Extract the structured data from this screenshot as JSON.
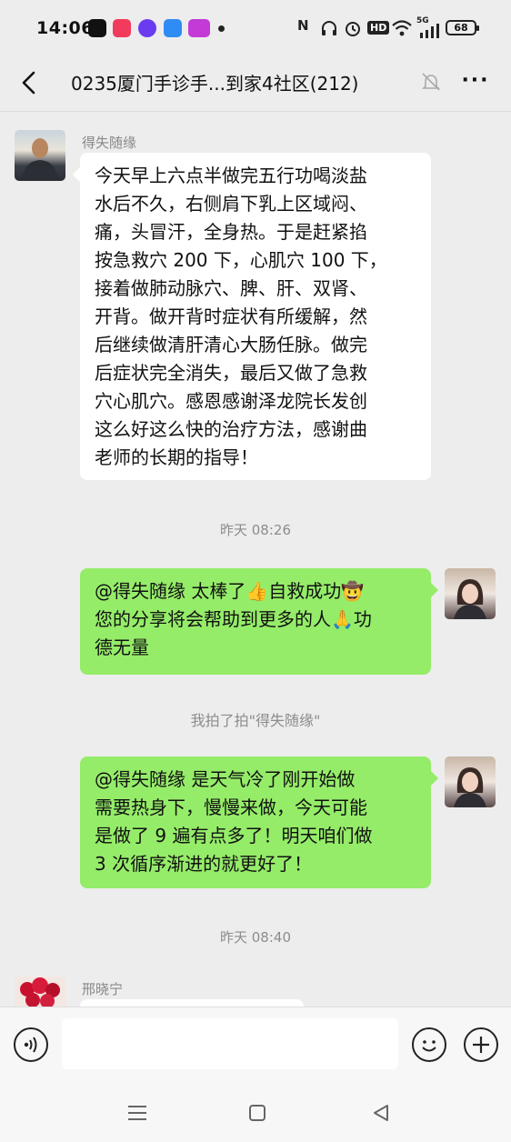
{
  "status_bar": {
    "time": "14:06",
    "battery": "68",
    "signal": "5G",
    "hd": "HD"
  },
  "header": {
    "title": "0235厦门手诊手...到家4社区(212)"
  },
  "messages": [
    {
      "type": "incoming",
      "sender": "得失随缘",
      "lines": [
        "今天早上六点半做完五行功喝淡盐",
        "水后不久，右侧肩下乳上区域闷、",
        "痛，头冒汗，全身热。于是赶紧掐",
        "按急救穴 200 下，心肌穴 100 下，",
        "接着做肺动脉穴、脾、肝、双肾、",
        "开背。做开背时症状有所缓解，然",
        "后继续做清肝清心大肠任脉。做完",
        "后症状完全消失，最后又做了急救",
        "穴心肌穴。感恩感谢泽龙院长发创",
        "这么好这么快的治疗方法，感谢曲",
        "老师的长期的指导！"
      ]
    },
    {
      "type": "time",
      "text": "昨天 08:26"
    },
    {
      "type": "outgoing",
      "lines": [
        "@得失随缘  太棒了👍自救成功🤠",
        "您的分享将会帮助到更多的人🙏功",
        "德无量"
      ]
    },
    {
      "type": "system",
      "text": "我拍了拍\"得失随缘\""
    },
    {
      "type": "outgoing",
      "lines": [
        "@得失随缘  是天气冷了刚开始做",
        "需要热身下，慢慢来做，今天可能",
        "是做了 9 遍有点多了！明天咱们做",
        "3 次循序渐进的就更好了！"
      ]
    },
    {
      "type": "time",
      "text": "昨天 08:40"
    },
    {
      "type": "incoming",
      "sender": "邢晓宁",
      "lines": []
    }
  ],
  "input": {
    "value": "",
    "placeholder": ""
  },
  "icons": {
    "back": "chevron-left-icon",
    "mute": "bell-off-icon",
    "more": "more-dots-icon",
    "voice": "voice-icon",
    "emoji": "emoji-icon",
    "plus": "plus-icon",
    "nav_menu": "menu-icon",
    "nav_home": "home-icon",
    "nav_back": "back-triangle-icon"
  },
  "colors": {
    "background": "#ededed",
    "outgoing_bubble": "#95ec69",
    "incoming_bubble": "#ffffff",
    "meta_text": "#8c8c8c"
  }
}
